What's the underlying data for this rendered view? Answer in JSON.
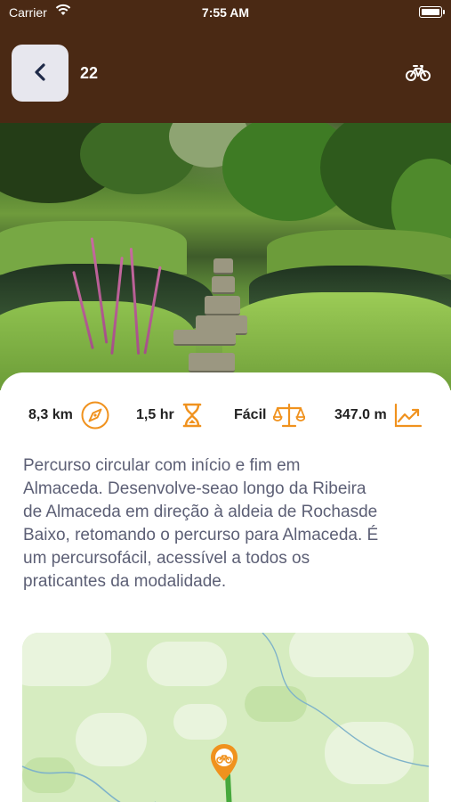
{
  "status_bar": {
    "carrier": "Carrier",
    "time": "7:55 AM"
  },
  "nav": {
    "title": "22",
    "back_icon": "chevron-left-icon",
    "mode_icon": "bicycle-icon",
    "background_color": "#4a2914"
  },
  "stats": [
    {
      "value": "8,3 km",
      "icon": "compass-icon"
    },
    {
      "value": "1,5 hr",
      "icon": "hourglass-icon"
    },
    {
      "value": "Fácil",
      "icon": "scale-icon"
    },
    {
      "value": "347.0 m",
      "icon": "elevation-chart-icon"
    }
  ],
  "description": "Percurso circular com início e fim em\nAlmaceda. Desenvolve-seao longo da Ribeira\nde Almaceda em direção à aldeia de Rochasde\nBaixo, retomando o percurso para Almaceda. É\num percursofácil, acessível a todos os\npraticantes da modalidade.",
  "map": {
    "pin_icon": "map-pin-bicycle-icon"
  },
  "colors": {
    "accent": "#f0921e",
    "text_body": "#5c5f75",
    "map_green": "#d6ecc0"
  }
}
